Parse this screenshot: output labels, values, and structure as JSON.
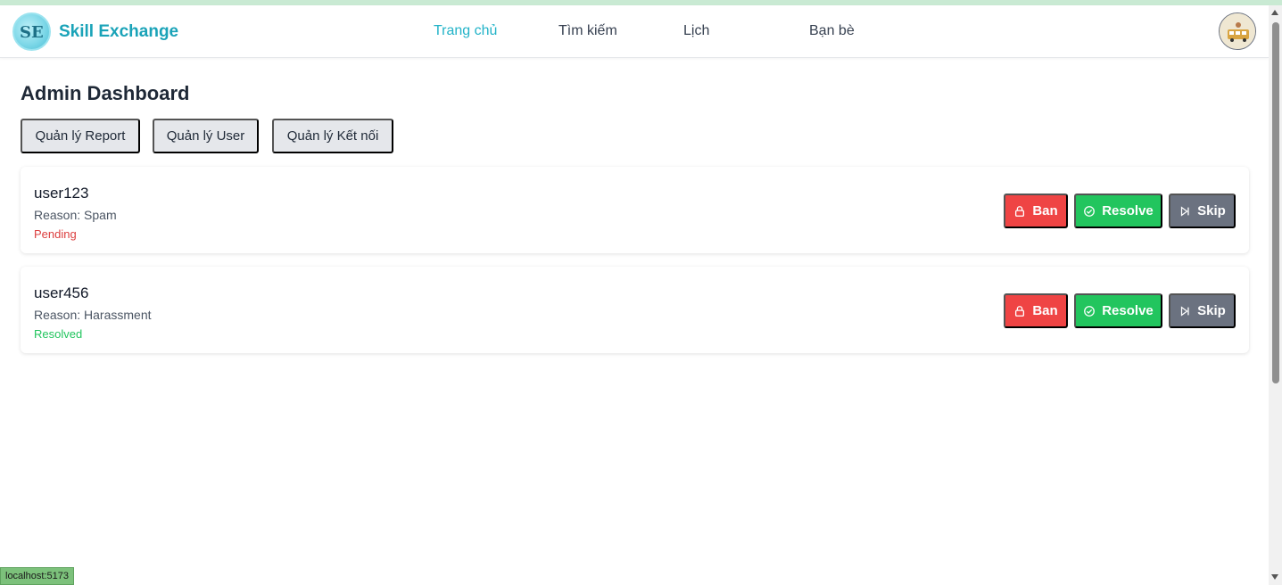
{
  "header": {
    "brand": "Skill Exchange",
    "logo_text": "SE",
    "nav": [
      {
        "label": "Trang chủ",
        "active": true
      },
      {
        "label": "Tìm kiếm",
        "active": false
      },
      {
        "label": "Lịch",
        "active": false
      },
      {
        "label": "Bạn bè",
        "active": false
      }
    ]
  },
  "main": {
    "title": "Admin Dashboard",
    "tabs": [
      {
        "label": "Quản lý Report"
      },
      {
        "label": "Quản lý User"
      },
      {
        "label": "Quản lý Kết nối"
      }
    ],
    "reports": [
      {
        "username": "user123",
        "reason": "Reason: Spam",
        "status": "Pending"
      },
      {
        "username": "user456",
        "reason": "Reason: Harassment",
        "status": "Resolved"
      }
    ],
    "actions": {
      "ban": "Ban",
      "resolve": "Resolve",
      "skip": "Skip"
    }
  },
  "statusbar": {
    "url": "localhost:5173"
  },
  "colors": {
    "brand": "#1aa3b8",
    "nav_active": "#22b3c8",
    "ban": "#ef4444",
    "resolve": "#22c55e",
    "skip": "#6b7280",
    "pending": "#dc3f3f",
    "resolved": "#22c55e"
  },
  "icons": {
    "ban": "lock-icon",
    "resolve": "check-circle-icon",
    "skip": "skip-forward-icon"
  }
}
